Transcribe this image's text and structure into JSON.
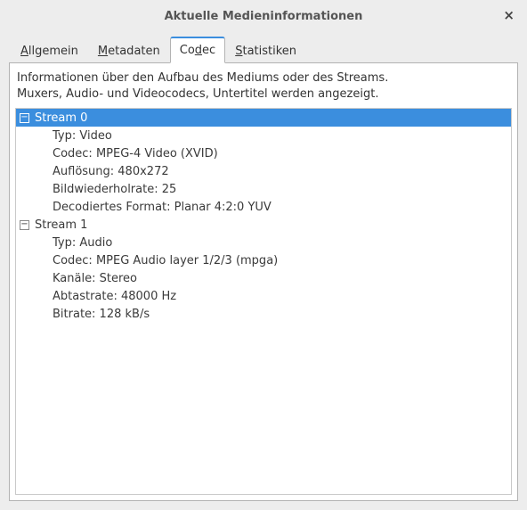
{
  "window": {
    "title": "Aktuelle Medieninformationen",
    "close_glyph": "×"
  },
  "tabs": [
    {
      "label_pre": "",
      "mn": "A",
      "label_post": "llgemein",
      "active": false
    },
    {
      "label_pre": "",
      "mn": "M",
      "label_post": "etadaten",
      "active": false
    },
    {
      "label_pre": "Co",
      "mn": "d",
      "label_post": "ec",
      "active": true
    },
    {
      "label_pre": "",
      "mn": "S",
      "label_post": "tatistiken",
      "active": false
    }
  ],
  "description": {
    "line1": "Informationen über den Aufbau des Mediums oder des Streams.",
    "line2": "Muxers, Audio- und Videocodecs, Untertitel werden angezeigt."
  },
  "streams": [
    {
      "name": "Stream 0",
      "selected": true,
      "props": [
        "Typ: Video",
        "Codec: MPEG-4 Video (XVID)",
        "Auflösung: 480x272",
        "Bildwiederholrate: 25",
        "Decodiertes Format: Planar 4:2:0 YUV"
      ]
    },
    {
      "name": "Stream 1",
      "selected": false,
      "props": [
        "Typ: Audio",
        "Codec: MPEG Audio layer 1/2/3 (mpga)",
        "Kanäle: Stereo",
        "Abtastrate: 48000 Hz",
        "Bitrate: 128 kB/s"
      ]
    }
  ],
  "expander_glyph": "−"
}
